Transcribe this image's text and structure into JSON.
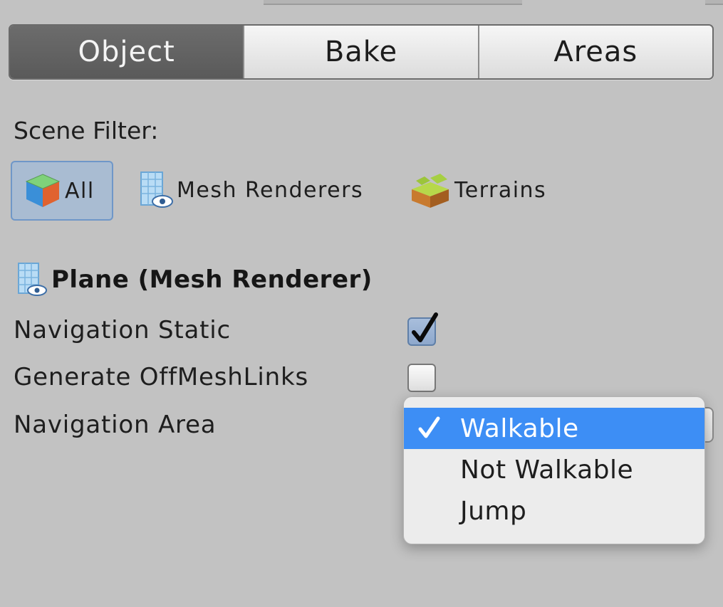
{
  "tabs": [
    {
      "label": "Object",
      "active": true
    },
    {
      "label": "Bake",
      "active": false
    },
    {
      "label": "Areas",
      "active": false
    }
  ],
  "scene_filter": {
    "label": "Scene Filter:",
    "options": [
      {
        "label": "All",
        "icon": "cube-icon",
        "selected": true
      },
      {
        "label": "Mesh Renderers",
        "icon": "mesh-renderer-icon",
        "selected": false
      },
      {
        "label": "Terrains",
        "icon": "terrain-icon",
        "selected": false
      }
    ]
  },
  "object": {
    "title": "Plane (Mesh Renderer)",
    "icon": "mesh-renderer-icon"
  },
  "properties": {
    "navigation_static": {
      "label": "Navigation Static",
      "checked": true
    },
    "generate_offmeshlinks": {
      "label": "Generate OffMeshLinks",
      "checked": false
    },
    "navigation_area": {
      "label": "Navigation Area",
      "value": "Walkable"
    }
  },
  "area_menu": {
    "items": [
      {
        "label": "Walkable",
        "selected": true
      },
      {
        "label": "Not Walkable",
        "selected": false
      },
      {
        "label": "Jump",
        "selected": false
      }
    ]
  },
  "colors": {
    "background": "#c2c2c2",
    "active_tab": "#606060",
    "selection_blue": "#3d8ef5",
    "filter_selected": "#a9bcd2"
  }
}
